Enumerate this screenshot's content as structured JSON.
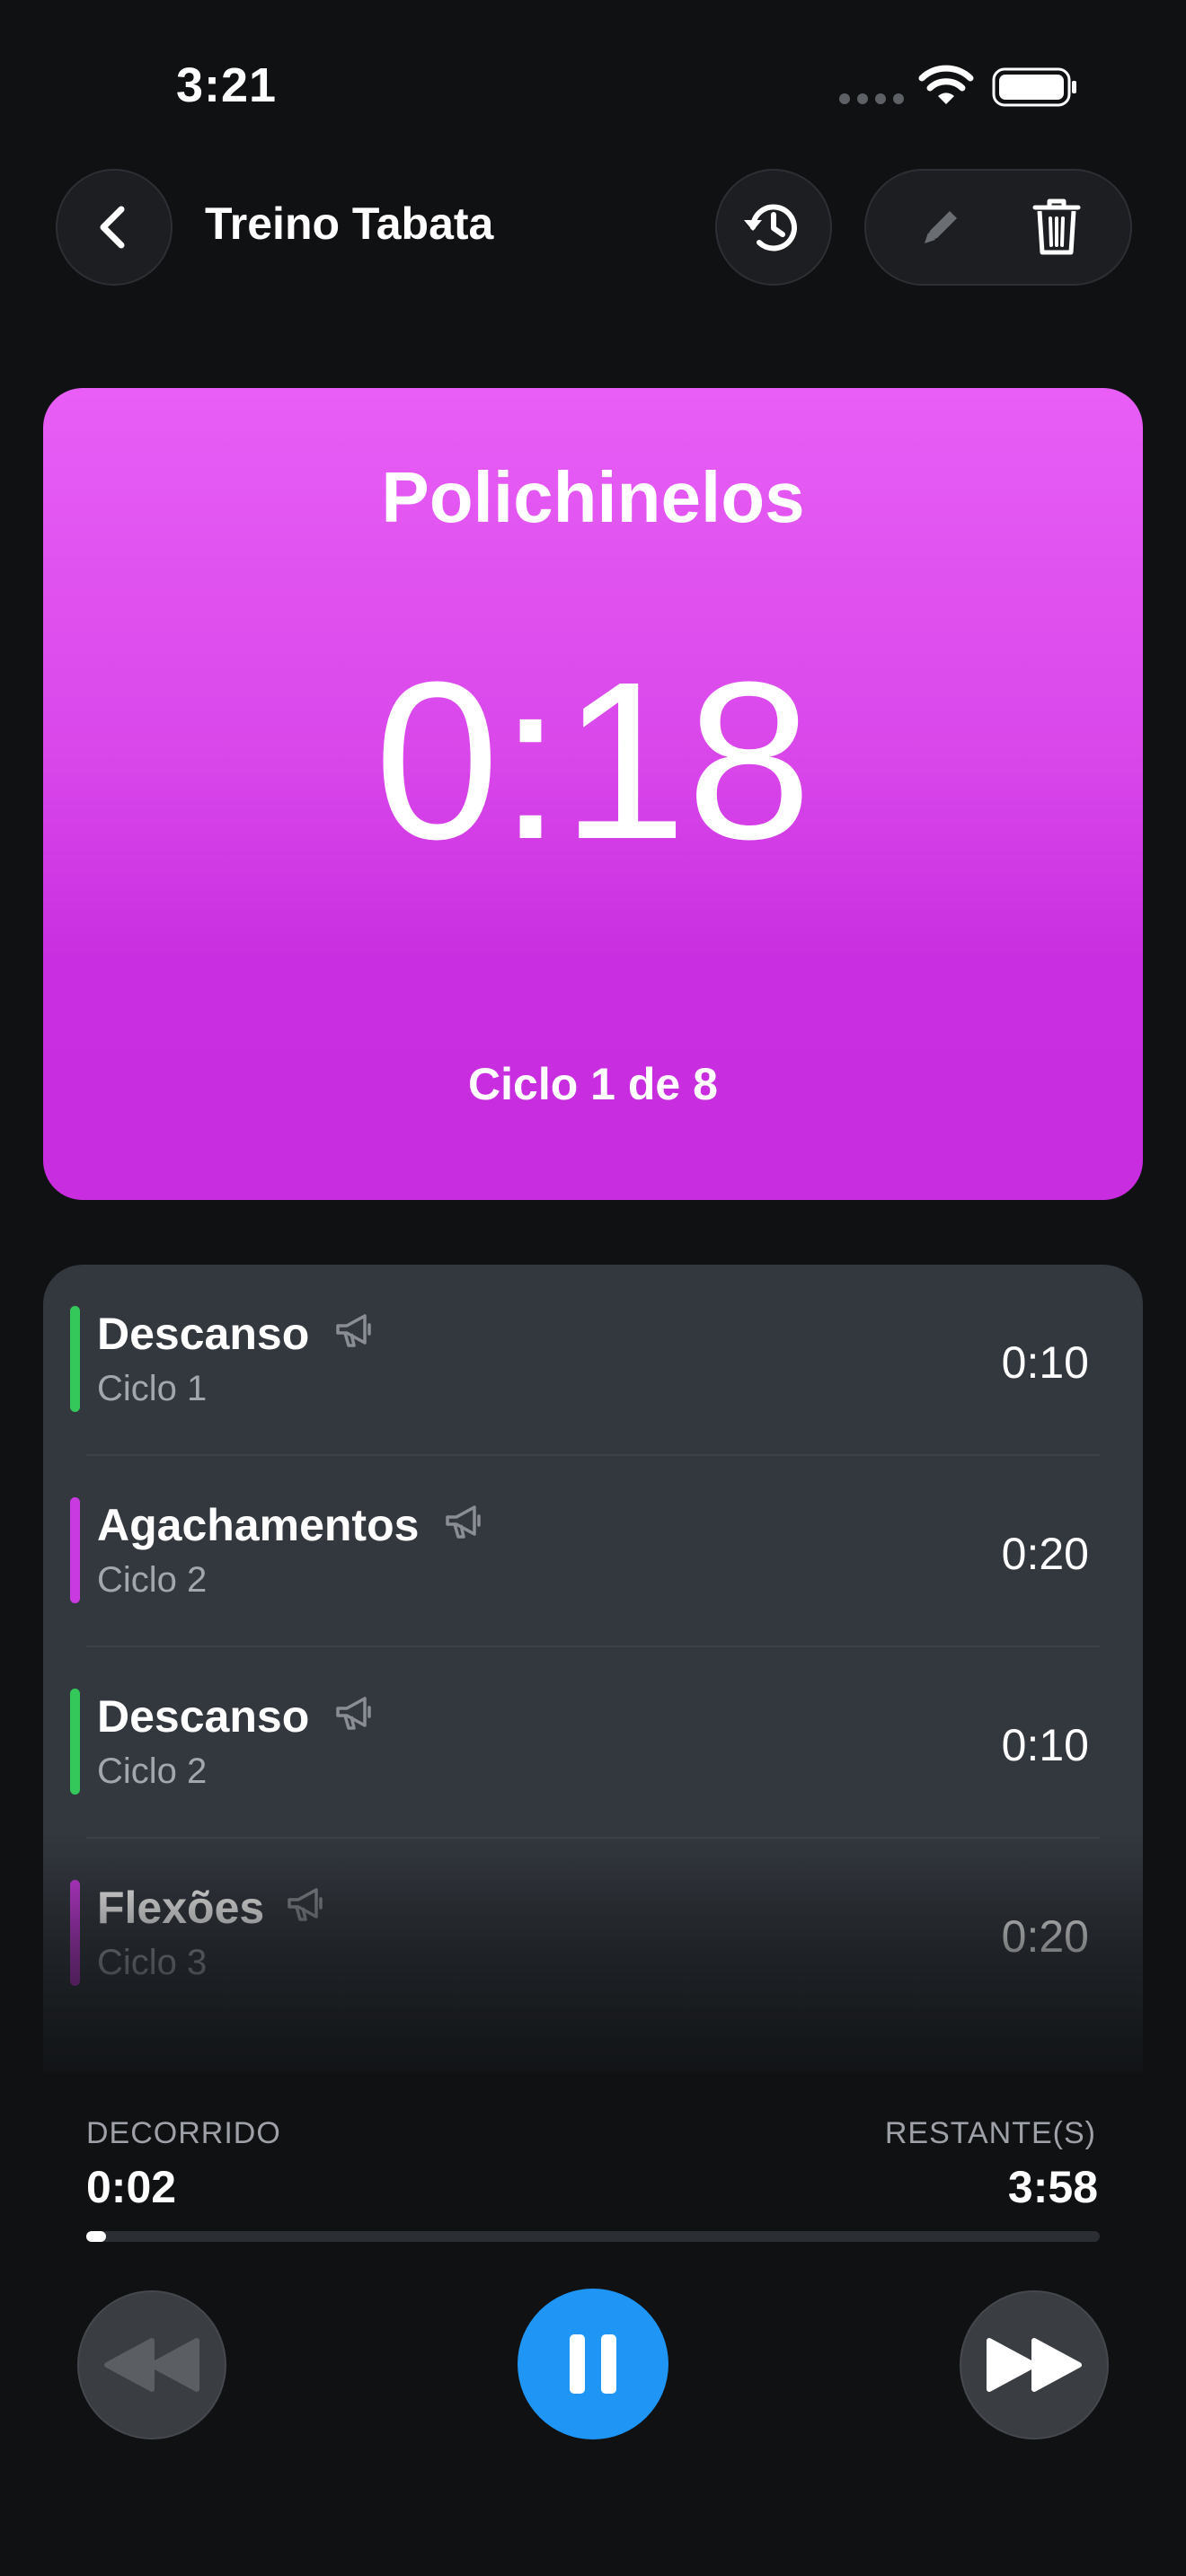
{
  "status_bar": {
    "time": "3:21"
  },
  "header": {
    "title": "Treino Tabata"
  },
  "current": {
    "name": "Polichinelos",
    "timer": "0:18",
    "cycle": "Ciclo 1 de 8",
    "color": "#d947ea"
  },
  "upcoming": [
    {
      "name": "Descanso",
      "cycle": "Ciclo 1",
      "duration": "0:10",
      "color": "#34c759"
    },
    {
      "name": "Agachamentos",
      "cycle": "Ciclo 2",
      "duration": "0:20",
      "color": "#c93ae0"
    },
    {
      "name": "Descanso",
      "cycle": "Ciclo 2",
      "duration": "0:10",
      "color": "#34c759"
    },
    {
      "name": "Flexões",
      "cycle": "Ciclo 3",
      "duration": "0:20",
      "color": "#c93ae0"
    }
  ],
  "progress": {
    "elapsed_label": "DECORRIDO",
    "elapsed": "0:02",
    "remaining_label": "RESTANTE(S)",
    "remaining": "3:58",
    "fraction": 0.0083
  },
  "icons": {
    "back": "chevron-left-icon",
    "history": "history-icon",
    "edit": "pencil-icon",
    "delete": "trash-icon",
    "announce": "megaphone-icon",
    "rewind": "rewind-icon",
    "pause": "pause-icon",
    "forward": "fast-forward-icon"
  },
  "colors": {
    "background": "#0f1113",
    "accent": "#1f95f5",
    "rest": "#34c759",
    "work": "#c93ae0"
  }
}
